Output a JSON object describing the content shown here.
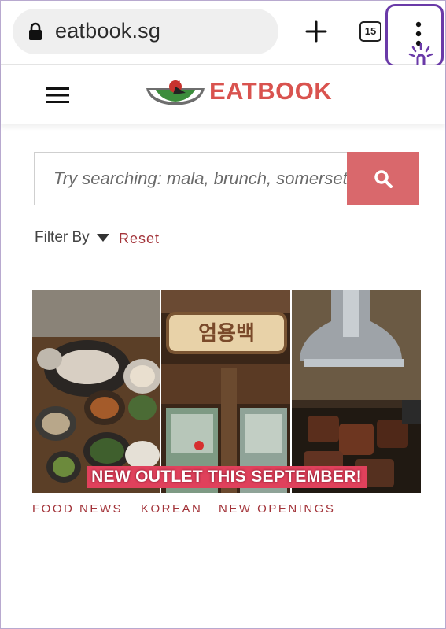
{
  "browser": {
    "url": "eatbook.sg",
    "tab_count": "15",
    "icons": [
      "lock-icon",
      "plus-icon",
      "tabs-icon",
      "menu-dots-icon",
      "pointer-hand-icon"
    ],
    "highlight_color": "#6a3aa8"
  },
  "header": {
    "logo_text": "EATBOOK",
    "brand_color": "#d9534f"
  },
  "search": {
    "placeholder": "Try searching: mala, brunch, somerset..",
    "button_color": "#d9686c"
  },
  "filter": {
    "label": "Filter By",
    "reset_label": "Reset"
  },
  "article": {
    "image_banner": "NEW OUTLET THIS SEPTEMBER!",
    "sign_text": "엄용백",
    "tags": [
      "FOOD NEWS",
      "KOREAN",
      "NEW OPENINGS"
    ]
  }
}
